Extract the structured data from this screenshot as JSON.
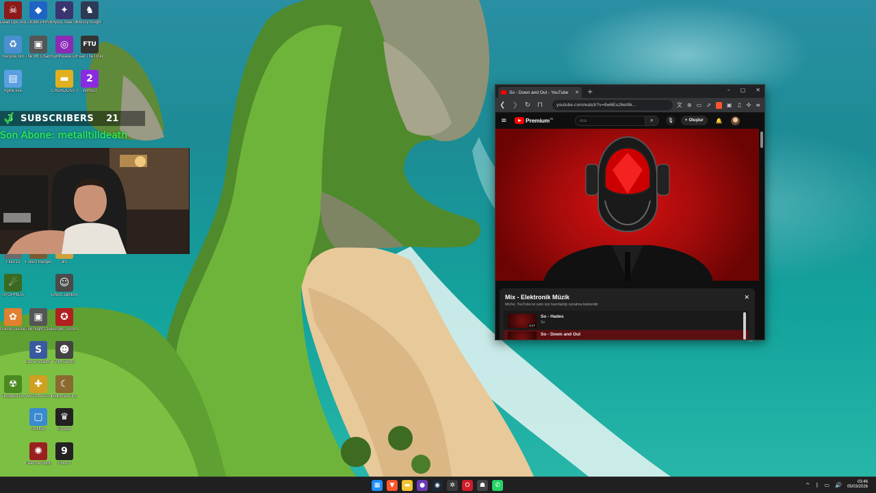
{
  "desktop_icons": [
    {
      "label": "Dead Ops Arcade",
      "color": "#8b1a1a",
      "glyph": "☠"
    },
    {
      "label": "LOGMEPRIVE Pretend",
      "color": "#1f63c4",
      "glyph": "◆"
    },
    {
      "label": "Mystic Vale Steam",
      "color": "#3a3470",
      "glyph": "✦"
    },
    {
      "label": "Mossy Knight Forest",
      "color": "#2d3a55",
      "glyph": "♞"
    },
    {
      "label": "Recycle Bin",
      "color": "#4a8fd0",
      "glyph": "♻"
    },
    {
      "label": "The 9th Channel",
      "color": "#555555",
      "glyph": "▣"
    },
    {
      "label": "Synthwave Driver",
      "color": "#8b2bb5",
      "glyph": "◎"
    },
    {
      "label": "Fear The Unknown",
      "color": "#333333",
      "glyph": "FTU"
    },
    {
      "label": "hgmk.exe",
      "color": "#5aa0e0",
      "glyph": "▤"
    },
    {
      "label": "CHORDOSS FOUNDE...",
      "color": "#e0b020",
      "glyph": "▬"
    },
    {
      "label": "Without",
      "color": "#8a2be2",
      "glyph": "2"
    },
    {
      "label": "Floor13",
      "color": "#6b6b6b",
      "glyph": "▥"
    },
    {
      "label": "Forest Ranger",
      "color": "#7a5a30",
      "glyph": "♣"
    },
    {
      "label": "drv",
      "color": "#d0a040",
      "glyph": "▬"
    },
    {
      "label": "UFOPHILIA",
      "color": "#3a6a20",
      "glyph": "☄"
    },
    {
      "label": "Ghost Janitors",
      "color": "#4a4a4a",
      "glyph": "☺"
    },
    {
      "label": "Goose Goose Duck",
      "color": "#e08030",
      "glyph": "✿"
    },
    {
      "label": "The Night Cleaner",
      "color": "#555555",
      "glyph": "▣"
    },
    {
      "label": "Burglin' Gnom...",
      "color": "#b02020",
      "glyph": "✪"
    },
    {
      "label": "Life & Shadow",
      "color": "#3a5aa0",
      "glyph": "S"
    },
    {
      "label": "Pilot Demo",
      "color": "#444444",
      "glyph": "☻"
    },
    {
      "label": "Dropped Up",
      "color": "#4a8a20",
      "glyph": "☢"
    },
    {
      "label": "We Gotta Go Deeper",
      "color": "#d0a020",
      "glyph": "✚"
    },
    {
      "label": "Nightmare Inside The",
      "color": "#8a6a30",
      "glyph": "☾"
    },
    {
      "label": "Untitled",
      "color": "#3a8ad0",
      "glyph": "▢"
    },
    {
      "label": "Escape",
      "color": "#222222",
      "glyph": "♛"
    },
    {
      "label": "Fear the Spotlight",
      "color": "#9a2020",
      "glyph": "✺"
    },
    {
      "label": "Floor 9",
      "color": "#222222",
      "glyph": "9"
    }
  ],
  "stream_overlay": {
    "subs_before": "3",
    "subs_label": "SUBSCRIBERS",
    "subs_count": "21",
    "last_subscriber": "Son Abone: metalltilldeath"
  },
  "browser": {
    "tab_title": "So - Down and Out - YouTube",
    "tab_close": "✕",
    "new_tab": "+",
    "window_controls": [
      "–",
      "▢",
      "✕"
    ],
    "url": "youtube.com/watch?v=8w6Eu26eI8k...",
    "youtube": {
      "brand": "Premium",
      "brand_sup": "TR",
      "search_placeholder": "Ara",
      "create_label": "Oluştur",
      "mix_title": "Mix - Elektronik Müzik",
      "mix_subtitle": "Mix'ler, YouTube'un sizin için hazırladığı oynatma listeleridir",
      "playlist": [
        {
          "title": "So - Hades",
          "channel": "So",
          "duration": "5:27",
          "active": false
        },
        {
          "title": "So - Down and Out",
          "channel": "",
          "duration": "",
          "active": true
        }
      ]
    }
  },
  "taskbar": {
    "time": "03:46",
    "date": "05/03/2026",
    "tray_caret": "^",
    "apps": [
      {
        "name": "windows-start",
        "color": "#1f8fff",
        "glyph": "▦"
      },
      {
        "name": "brave",
        "color": "#fb542b",
        "glyph": "▼"
      },
      {
        "name": "file-explorer",
        "color": "#f3c431",
        "glyph": "▬"
      },
      {
        "name": "obs",
        "color": "#6b3ab5",
        "glyph": "●"
      },
      {
        "name": "steam",
        "color": "#1b2838",
        "glyph": "◉"
      },
      {
        "name": "chatgpt",
        "color": "#3a3a3a",
        "glyph": "✲"
      },
      {
        "name": "opera",
        "color": "#d01c2a",
        "glyph": "O"
      },
      {
        "name": "game-launcher",
        "color": "#444444",
        "glyph": "☗"
      },
      {
        "name": "whatsapp",
        "color": "#25d366",
        "glyph": "✆"
      }
    ]
  }
}
